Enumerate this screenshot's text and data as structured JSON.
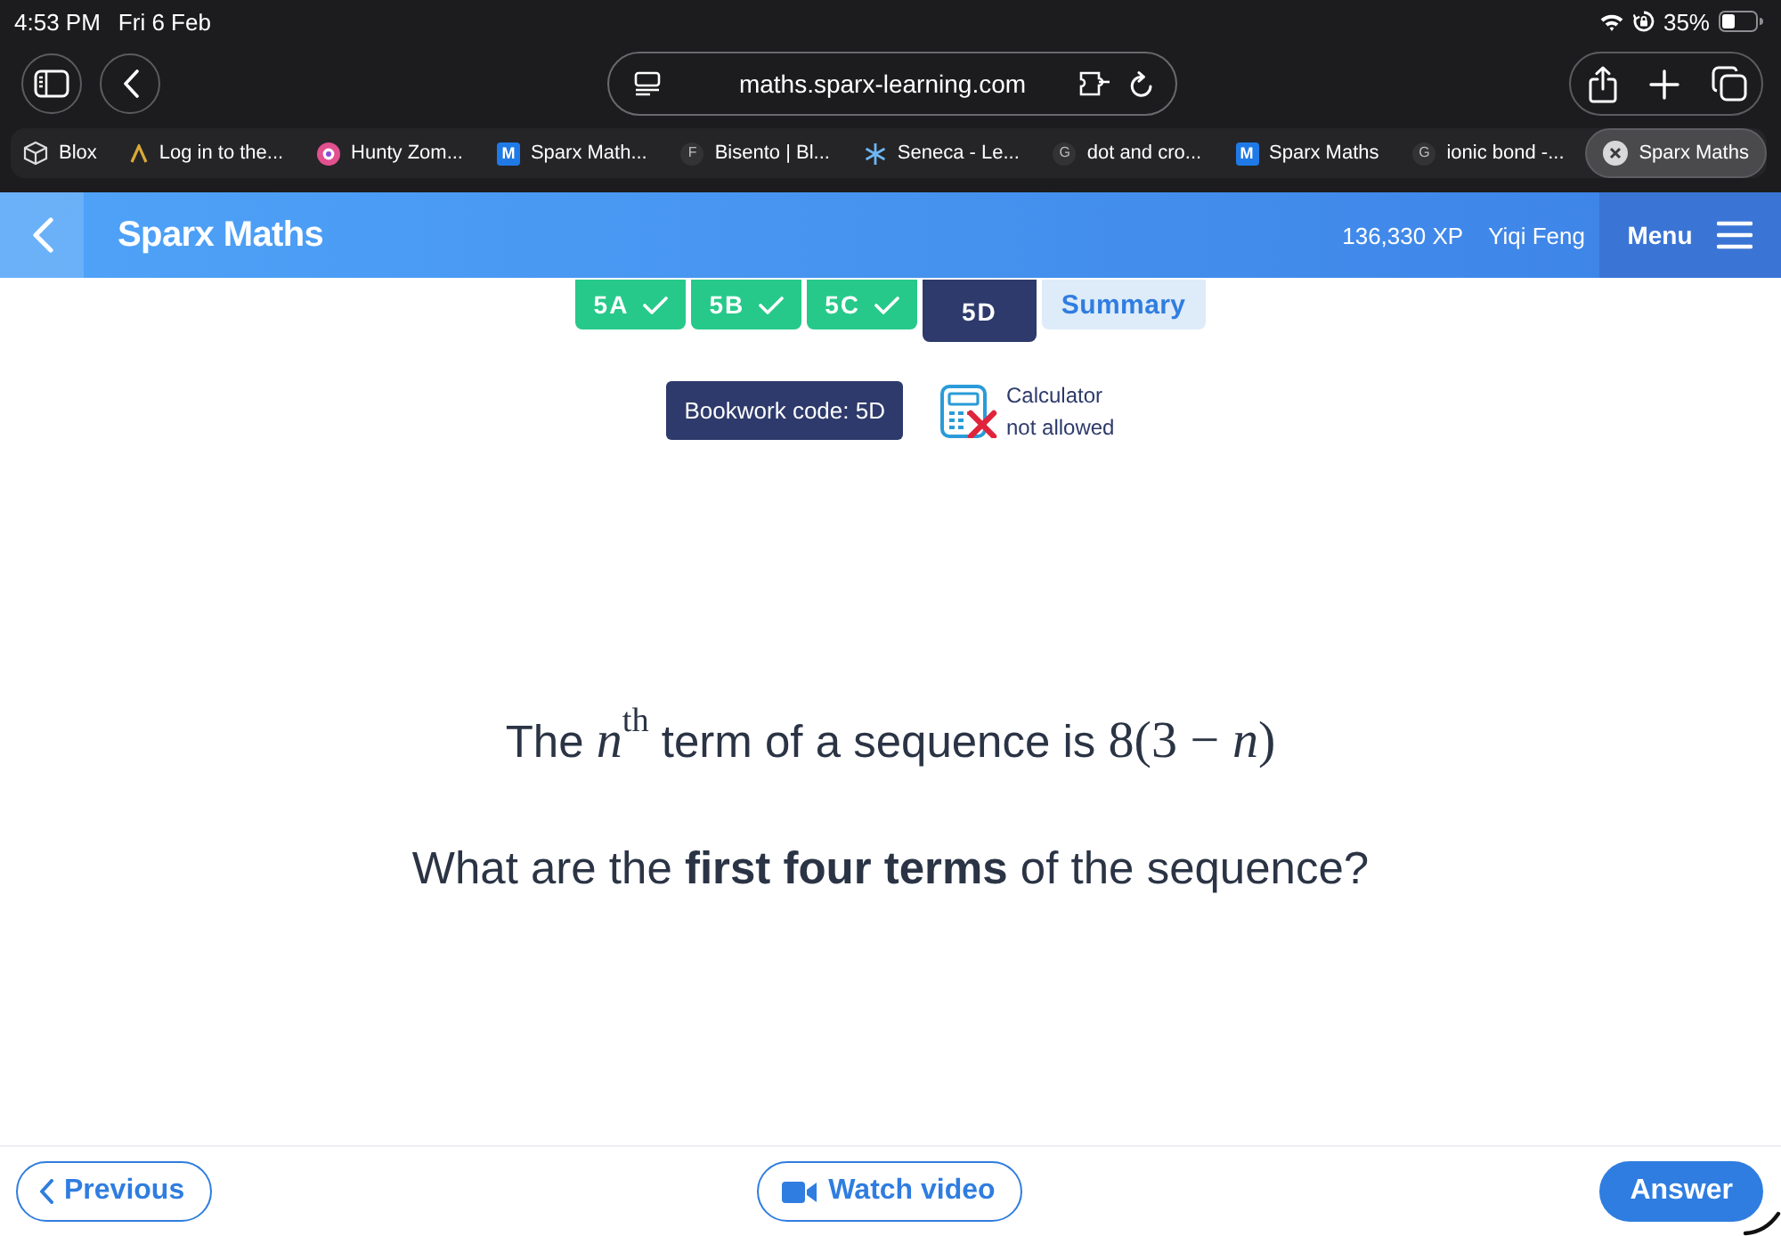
{
  "status_bar": {
    "time": "4:53 PM",
    "date": "Fri 6 Feb",
    "battery": "35%"
  },
  "browser": {
    "url": "maths.sparx-learning.com",
    "tabs": [
      {
        "kind": "cube",
        "label": "Blox",
        "selected": false
      },
      {
        "kind": "caret",
        "label": "Log in to the...",
        "selected": false
      },
      {
        "kind": "ring",
        "label": "Hunty Zom...",
        "selected": false
      },
      {
        "kind": "tile",
        "favicon": "M",
        "label": "Sparx Math...",
        "selected": false
      },
      {
        "kind": "letter",
        "favicon": "F",
        "label": "Bisento | Bl...",
        "selected": false
      },
      {
        "kind": "snowflake",
        "label": "Seneca - Le...",
        "selected": false
      },
      {
        "kind": "letter",
        "favicon": "G",
        "label": "dot and cro...",
        "selected": false
      },
      {
        "kind": "tile",
        "favicon": "M",
        "label": "Sparx Maths",
        "selected": false
      },
      {
        "kind": "letter",
        "favicon": "G",
        "label": "ionic bond -...",
        "selected": false
      },
      {
        "kind": "close",
        "label": "Sparx Maths",
        "selected": true
      }
    ]
  },
  "header": {
    "title": "Sparx Maths",
    "xp": "136,330 XP",
    "user": "Yiqi Feng",
    "menu": "Menu"
  },
  "task_tabs": [
    {
      "kind": "task",
      "label": "5A",
      "done": true,
      "selected": false
    },
    {
      "kind": "task",
      "label": "5B",
      "done": true,
      "selected": false
    },
    {
      "kind": "task",
      "label": "5C",
      "done": true,
      "selected": false
    },
    {
      "kind": "task",
      "label": "5D",
      "done": false,
      "selected": true
    },
    {
      "kind": "summary",
      "label": "Summary",
      "selected": false
    }
  ],
  "bookwork": {
    "code": "Bookwork code: 5D",
    "calculator": {
      "lines": [
        "Calculator",
        "not allowed"
      ],
      "allowed": false
    }
  },
  "question": {
    "lines": [
      {
        "parts": [
          {
            "kind": "text",
            "text": "The "
          },
          {
            "kind": "math",
            "text": "*n*$^{th}$"
          },
          {
            "kind": "text",
            "text": " term of a sequence is "
          },
          {
            "kind": "math",
            "text": "8(3 − *n*)"
          }
        ]
      },
      {
        "parts": [
          {
            "kind": "text",
            "text": "What are the **first four terms** of the sequence?"
          }
        ]
      }
    ]
  },
  "footer": {
    "previous": "Previous",
    "watch_video": "Watch video",
    "answer": "Answer"
  }
}
